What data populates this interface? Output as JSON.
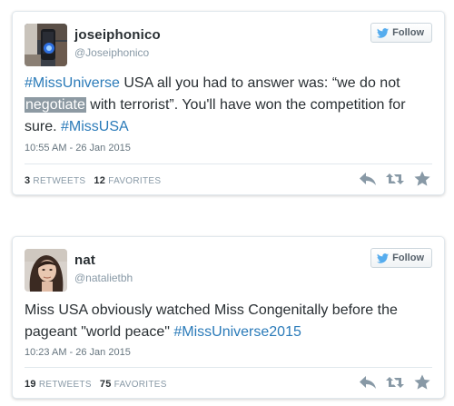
{
  "tweets": [
    {
      "name": "joseiphonico",
      "handle": "@Joseiphonico",
      "follow_label": "Follow",
      "text_parts": [
        {
          "t": "#MissUniverse",
          "style": "hashtag"
        },
        {
          "t": " USA all you had to answer was: “we do not ",
          "style": "plain"
        },
        {
          "t": "negotiate",
          "style": "highlight"
        },
        {
          "t": " with terrorist”. You'll have won the competition for sure. ",
          "style": "plain"
        },
        {
          "t": "#MissUSA",
          "style": "hashtag"
        }
      ],
      "timestamp": "10:55 AM - 26 Jan 2015",
      "retweets": "3",
      "retweets_label": "RETWEETS",
      "favorites": "12",
      "favorites_label": "FAVORITES"
    },
    {
      "name": "nat",
      "handle": "@natalietbh",
      "follow_label": "Follow",
      "text_parts": [
        {
          "t": "Miss USA obviously watched Miss Congenitally before the pageant \"world peace\" ",
          "style": "plain"
        },
        {
          "t": "#MissUniverse2015",
          "style": "hashtag"
        }
      ],
      "timestamp": "10:23 AM - 26 Jan 2015",
      "retweets": "19",
      "retweets_label": "RETWEETS",
      "favorites": "75",
      "favorites_label": "FAVORITES"
    }
  ],
  "icons": {
    "follow": "twitter-bird-icon",
    "reply": "reply-icon",
    "retweet": "retweet-icon",
    "favorite": "star-icon"
  },
  "colors": {
    "link": "#2b7bb9",
    "twitter_blue": "#55acee",
    "muted": "#8899a6",
    "action_icon": "#8899a6",
    "text": "#292f33"
  }
}
